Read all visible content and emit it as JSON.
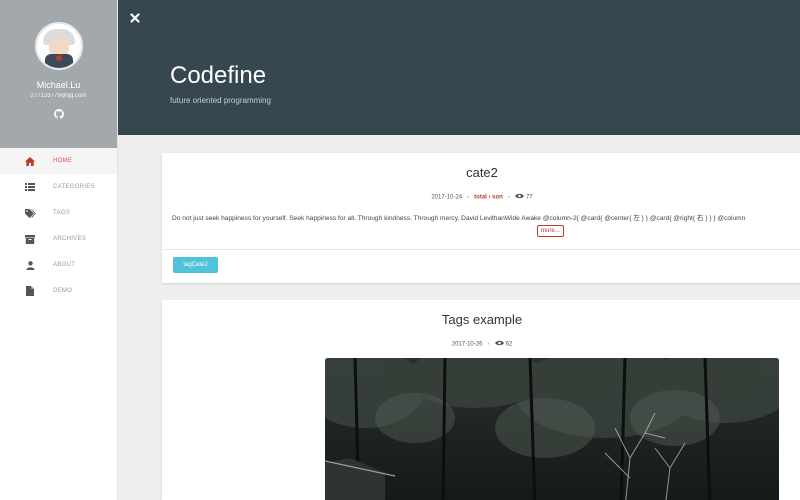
{
  "profile": {
    "name": "Michael.Lu",
    "email": "277133779@qq.com"
  },
  "nav": [
    {
      "label": "HOME",
      "icon": "home-icon",
      "active": true
    },
    {
      "label": "CATEGORIES",
      "icon": "list-icon",
      "active": false
    },
    {
      "label": "TAGS",
      "icon": "tags-icon",
      "active": false
    },
    {
      "label": "ARCHIVES",
      "icon": "archive-icon",
      "active": false
    },
    {
      "label": "ABOUT",
      "icon": "user-icon",
      "active": false
    },
    {
      "label": "DEMO",
      "icon": "file-icon",
      "active": false
    }
  ],
  "header": {
    "title": "Codefine",
    "subtitle": "future oriented programming"
  },
  "posts": [
    {
      "title": "cate2",
      "date": "2017-10-24",
      "category": "total",
      "category_sep": "›",
      "subcategory": "son",
      "views": "77",
      "excerpt": "Do not just seek happiness for yourself. Seek happiness for all. Through kindness. Through mercy. David LevithanWide Awake @column-2{ @card{ @center{ 左 } } @card{ @right{ 右 } } } @column",
      "more_label": "more...",
      "tag": "tagCate2"
    },
    {
      "title": "Tags example",
      "date": "2017-10-26",
      "views": "62"
    }
  ],
  "colors": {
    "accent": "#c0392b",
    "header_bg": "#36474f",
    "profile_bg": "#a2a8ab",
    "tag_bg": "#4fc3d9"
  }
}
